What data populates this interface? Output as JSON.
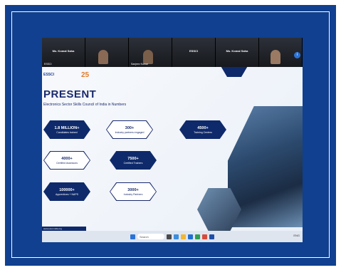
{
  "meeting": {
    "participants": [
      {
        "name": "Ms. Komal Saha",
        "subname": "ESSCI"
      },
      {
        "name": "",
        "subname": ""
      },
      {
        "name": "",
        "subname": "Sanjeev Kumar"
      },
      {
        "name": "ESSCI",
        "subname": ""
      },
      {
        "name": "Ms. Komal Saha",
        "subname": ""
      },
      {
        "name": "",
        "subname": ""
      }
    ]
  },
  "slide": {
    "logo": "ESSCI",
    "anniversary": "25",
    "title": "PRESENT",
    "subtitle": "Electronics Sector Skills Council of India in Numbers",
    "stats": [
      {
        "value": "1.8 MILLION+",
        "label": "Candidates trained"
      },
      {
        "value": "300+",
        "label": "Industry partners engaged"
      },
      {
        "value": "4500+",
        "label": "Training Centers"
      },
      {
        "value": "4000+",
        "label": "Certified Assessors"
      },
      {
        "value": "7500+",
        "label": "Certified Trainers"
      },
      {
        "value": "100000+",
        "label": "Apprentices + NAPS"
      },
      {
        "value": "3000+",
        "label": "Industry Partners"
      }
    ],
    "footer": "www.essc-india.org"
  },
  "taskbar": {
    "search_placeholder": "Search",
    "tray": "ENG"
  },
  "colors": {
    "frame": "#10408f",
    "slide_navy": "#0f2a6b"
  }
}
